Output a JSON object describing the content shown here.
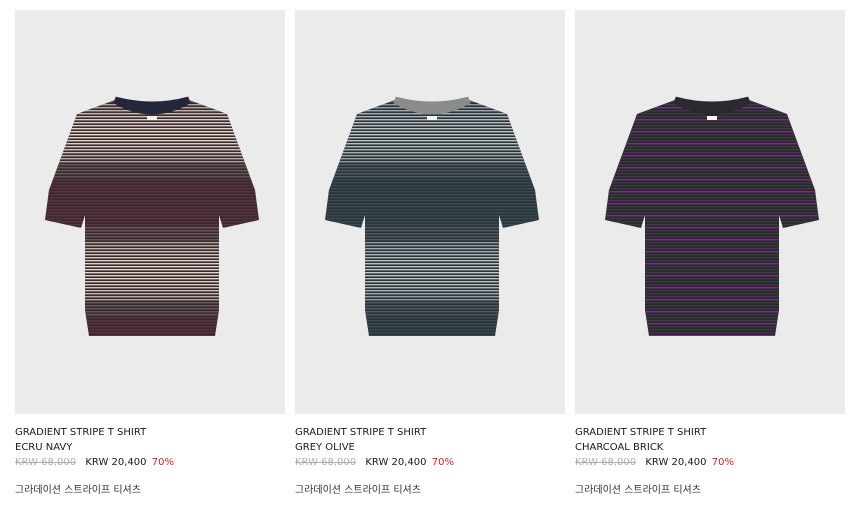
{
  "products": [
    {
      "name": "GRADIENT STRIPE T SHIRT",
      "color": "ECRU NAVY",
      "original_price": "KRW 68,000",
      "sale_price": "KRW 20,400",
      "discount": "70%",
      "korean_name": "그라데이션 스트라이프 티셔츠",
      "image_alt": "gradient-stripe-tshirt-ecru-navy",
      "palette": {
        "body": "#3a2a30",
        "light": "#e8e2d4",
        "accent": "#7a3a50",
        "collar": "#24263a"
      }
    },
    {
      "name": "GRADIENT STRIPE T SHIRT",
      "color": "GREY OLIVE",
      "original_price": "KRW 68,000",
      "sale_price": "KRW 20,400",
      "discount": "70%",
      "korean_name": "그라데이션 스트라이프 티셔츠",
      "image_alt": "gradient-stripe-tshirt-grey-olive",
      "palette": {
        "body": "#2a343a",
        "light": "#c8cccc",
        "accent": "#4a6068",
        "collar": "#8a8c8c"
      }
    },
    {
      "name": "GRADIENT STRIPE T SHIRT",
      "color": "CHARCOAL BRICK",
      "original_price": "KRW 68,000",
      "sale_price": "KRW 20,400",
      "discount": "70%",
      "korean_name": "그라데이션 스트라이프 티셔츠",
      "image_alt": "gradient-stripe-tshirt-charcoal-brick",
      "palette": {
        "body": "#2a2a2e",
        "light": "#5a5a60",
        "accent": "#8a2a9a",
        "collar": "#2a2a2e"
      }
    }
  ],
  "colors": {
    "discount": "#e02020",
    "old_price": "#b0b0b0",
    "image_bg": "#ebebeb"
  }
}
